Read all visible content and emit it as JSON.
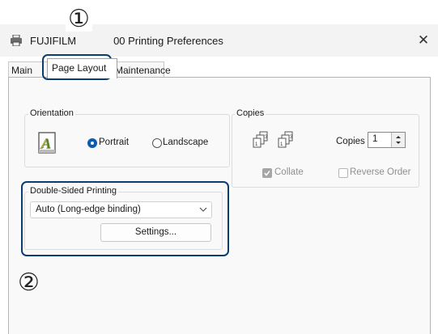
{
  "window": {
    "title_prefix": "FUJIFILM",
    "title_suffix": "00 Printing Preferences",
    "close_glyph": "✕"
  },
  "tabs": [
    {
      "label": "Main",
      "selected": false
    },
    {
      "label": "Page Layout",
      "selected": true
    },
    {
      "label": "Maintenance",
      "selected": false
    }
  ],
  "orientation": {
    "group_label": "Orientation",
    "icon": "portrait-a-icon",
    "portrait_label": "Portrait",
    "landscape_label": "Landscape",
    "selected": "Portrait"
  },
  "copies": {
    "group_label": "Copies",
    "field_label": "Copies",
    "value": "1",
    "collate_label": "Collate",
    "collate_checked": true,
    "reverse_label": "Reverse Order",
    "reverse_checked": false
  },
  "double_sided": {
    "group_label": "Double-Sided Printing",
    "selected": "Auto (Long-edge binding)",
    "settings_label": "Settings..."
  },
  "callouts": {
    "one": "①",
    "two": "②"
  },
  "colors": {
    "highlight": "#0b3d73",
    "accent": "#0b5cad"
  }
}
